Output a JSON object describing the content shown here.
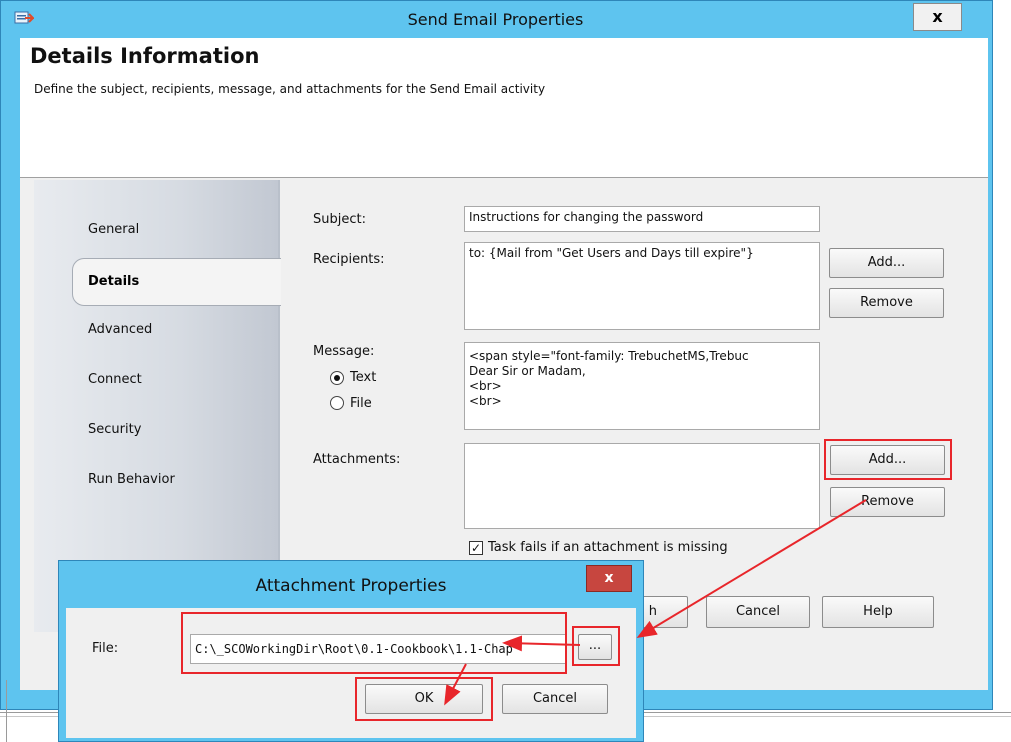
{
  "window": {
    "title": "Send Email Properties",
    "close_glyph": "x",
    "icon": "app-icon"
  },
  "header": {
    "title": "Details Information",
    "description": "Define the subject, recipients, message, and attachments for the Send Email activity"
  },
  "sidebar": {
    "items": [
      {
        "label": "General"
      },
      {
        "label": "Details",
        "selected": true
      },
      {
        "label": "Advanced"
      },
      {
        "label": "Connect"
      },
      {
        "label": "Security"
      },
      {
        "label": "Run Behavior"
      }
    ]
  },
  "details": {
    "subject_label": "Subject:",
    "subject_value": "Instructions for changing the password",
    "recipients_label": "Recipients:",
    "recipients_value": "to: {Mail from \"Get Users and Days till expire\"}",
    "recipients_add": "Add...",
    "recipients_remove": "Remove",
    "message_label": "Message:",
    "message_type_text": "Text",
    "message_type_file": "File",
    "message_type_selected": "Text",
    "message_lines": [
      "<span style=\"font-family: TrebuchetMS,Trebuc",
      "Dear Sir or Madam,",
      "<br>",
      "<br>"
    ],
    "attachments_label": "Attachments:",
    "attachments_add": "Add...",
    "attachments_remove": "Remove",
    "task_fails_label": "Task fails if an attachment is missing",
    "task_fails_checked": true
  },
  "footer": {
    "finish_partial": "h",
    "cancel": "Cancel",
    "help": "Help"
  },
  "attachment_dialog": {
    "title": "Attachment Properties",
    "close_glyph": "x",
    "file_label": "File:",
    "file_value": "C:\\_SCOWorkingDir\\Root\\0.1-Cookbook\\1.1-Chap",
    "browse": "...",
    "ok": "OK",
    "cancel": "Cancel"
  },
  "colors": {
    "title_bar": "#5ec4ef",
    "highlight": "#e8262b",
    "close_active": "#c7463f"
  }
}
